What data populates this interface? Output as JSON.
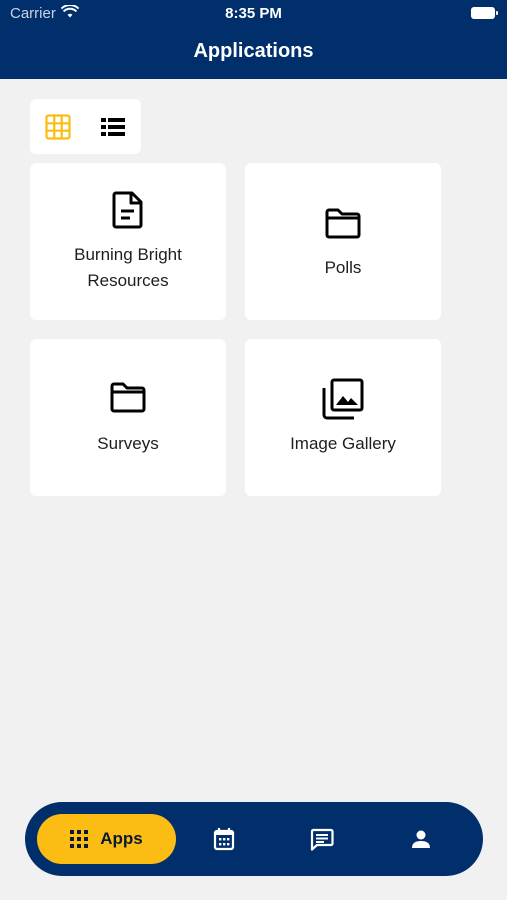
{
  "status_bar": {
    "carrier": "Carrier",
    "time": "8:35 PM"
  },
  "header": {
    "title": "Applications"
  },
  "view_toggle": {
    "active": "grid",
    "accent_color": "#fbbd13"
  },
  "apps": [
    {
      "label_line1": "Burning Bright",
      "label_line2": "Resources",
      "icon": "document-icon"
    },
    {
      "label": "Polls",
      "icon": "folder-icon"
    },
    {
      "label": "Surveys",
      "icon": "folder-icon"
    },
    {
      "label": "Image Gallery",
      "icon": "photo-library-icon"
    }
  ],
  "tabbar": {
    "active_label": "Apps",
    "tabs": [
      "apps-grid-icon",
      "calendar-icon",
      "chat-icon",
      "person-icon"
    ],
    "background": "#002f6c",
    "active_color": "#fbbd13"
  }
}
